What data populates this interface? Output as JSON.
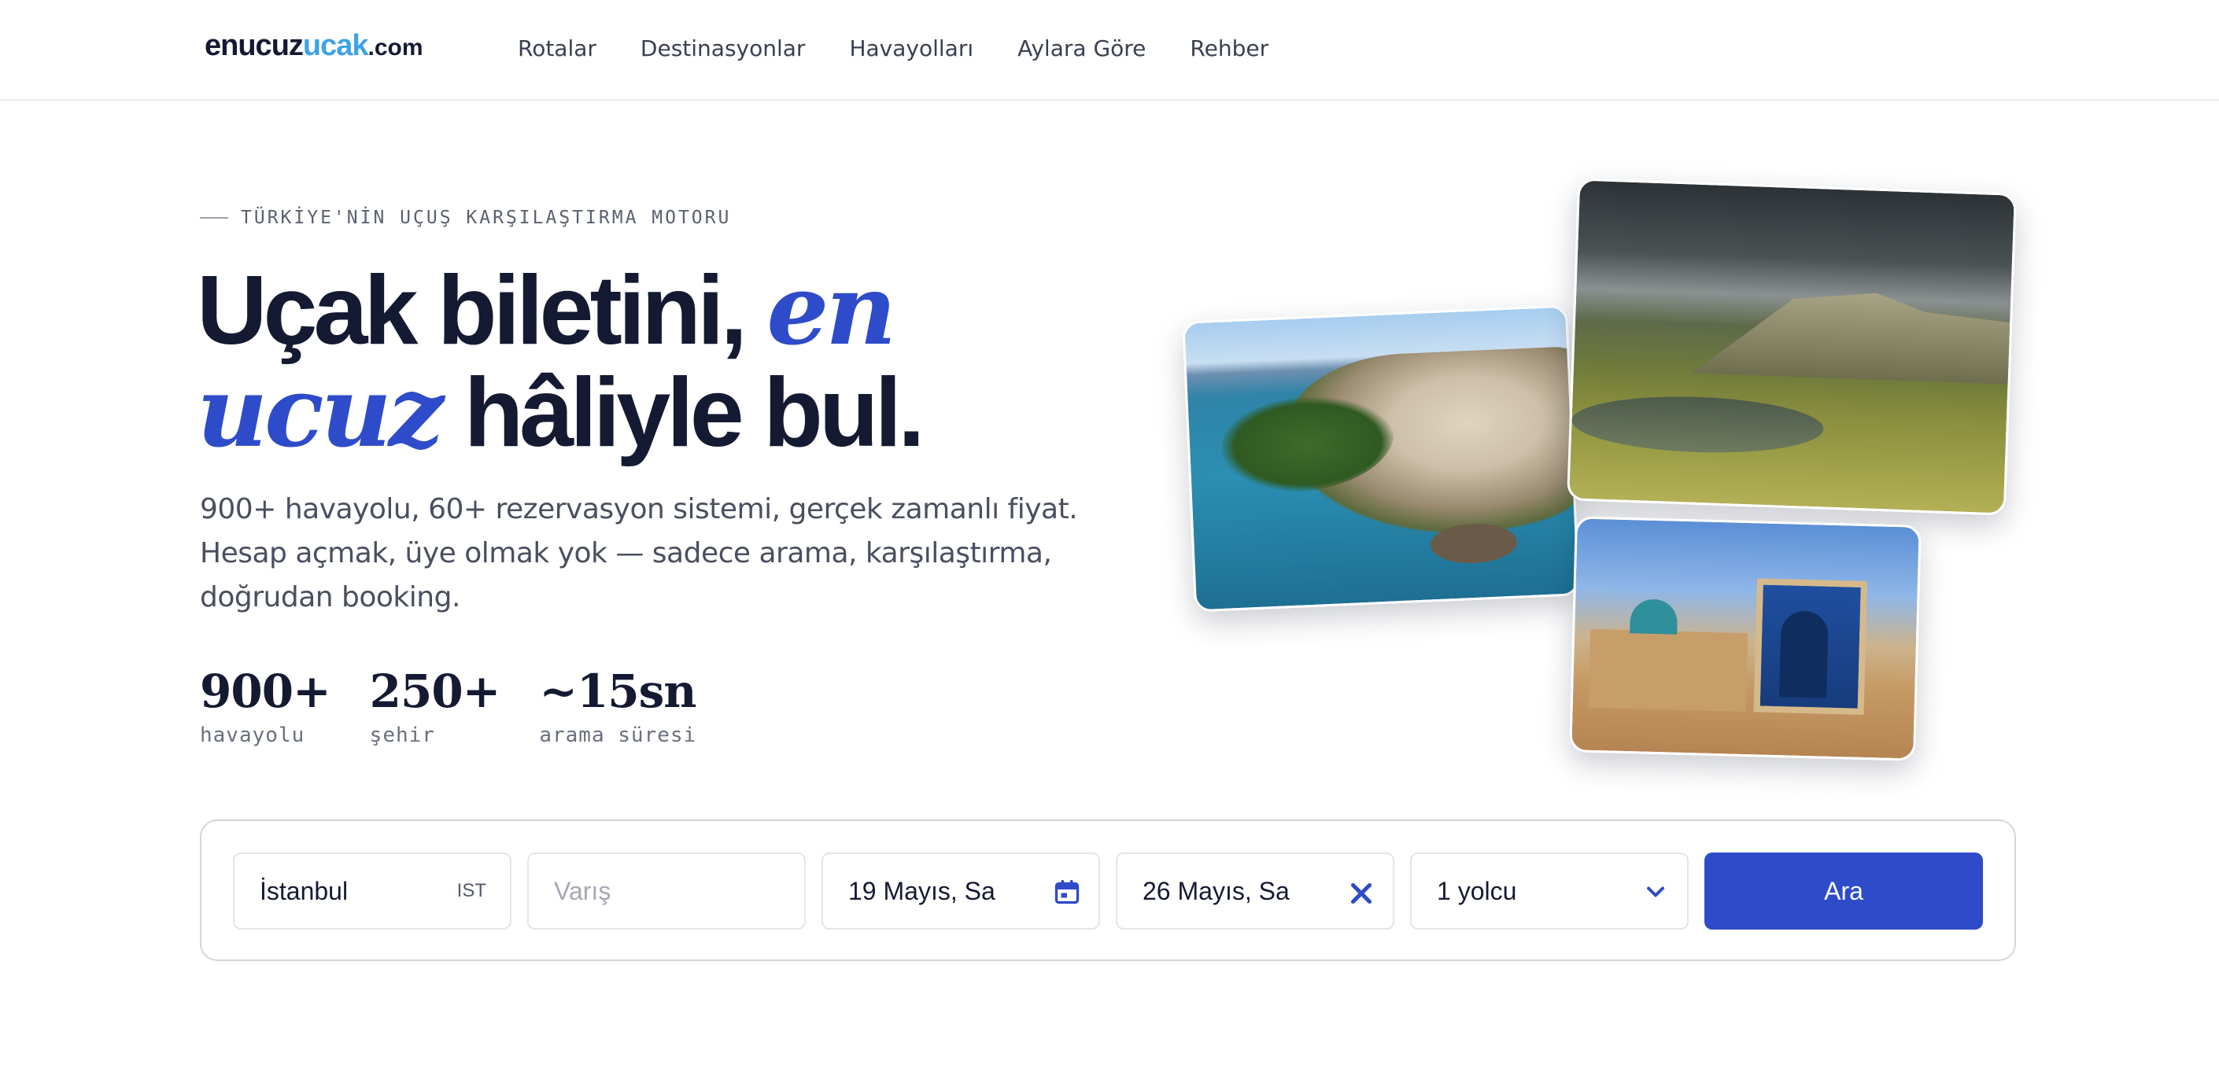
{
  "header": {
    "logo": {
      "part1": "enucuz",
      "part2": "ucak",
      "part3": ".com"
    },
    "nav": [
      "Rotalar",
      "Destinasyonlar",
      "Havayolları",
      "Aylara Göre",
      "Rehber"
    ]
  },
  "hero": {
    "eyebrow": "TÜRKİYE'NİN UÇUŞ KARŞILAŞTIRMA MOTORU",
    "headline": {
      "part1": "Uçak biletini, ",
      "accent1": "en",
      "accent2": "ucuz",
      "part2": " hâliyle bul."
    },
    "subtext": "900+ havayolu, 60+ rezervasyon sistemi, gerçek zamanlı fiyat. Hesap açmak, üye olmak yok — sadece arama, karşılaştırma, doğrudan booking.",
    "stats": [
      {
        "value": "900+",
        "label": "havayolu"
      },
      {
        "value": "250+",
        "label": "şehir"
      },
      {
        "value": "~15sn",
        "label": "arama süresi"
      }
    ]
  },
  "search": {
    "origin": {
      "value": "İstanbul",
      "code": "IST"
    },
    "destination": {
      "placeholder": "Varış"
    },
    "depart_date": "19 Mayıs, Sa",
    "return_date": "26 Mayıs, Sa",
    "passengers": "1 yolcu",
    "submit_label": "Ara"
  },
  "colors": {
    "accent": "#2e4bc9",
    "logo_accent": "#3ea3e6",
    "text": "#151a33"
  },
  "icons": {
    "calendar": "calendar-icon",
    "clear": "close-icon",
    "dropdown": "chevron-down-icon"
  }
}
